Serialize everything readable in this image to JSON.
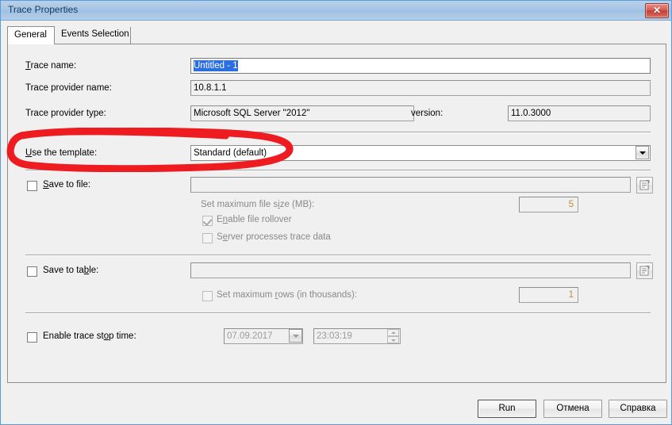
{
  "window": {
    "title": "Trace Properties",
    "close_label": "✕"
  },
  "tabs": [
    {
      "label": "General",
      "active": true
    },
    {
      "label": "Events Selection",
      "active": false
    }
  ],
  "general": {
    "trace_name": {
      "label": "Trace name:",
      "value": "Untitled - 1",
      "selected": true
    },
    "trace_provider_name": {
      "label": "Trace provider name:",
      "value": "10.8.1.1"
    },
    "trace_provider_type": {
      "label": "Trace provider type:",
      "value": "Microsoft SQL Server \"2012\""
    },
    "version": {
      "label": "version:",
      "value": "11.0.3000"
    },
    "template": {
      "label": "Use the template:",
      "value": "Standard (default)",
      "highlighted": true
    },
    "save_to_file": {
      "label": "Save to file:",
      "checked": false,
      "path_value": "",
      "browse_icon": "folder-open-icon",
      "max_file_size": {
        "label": "Set maximum file size (MB):",
        "value": "5",
        "enabled": false
      },
      "enable_rollover": {
        "label": "Enable file rollover",
        "checked": true,
        "enabled": false
      },
      "server_processes": {
        "label": "Server processes trace data",
        "checked": false,
        "enabled": false
      }
    },
    "save_to_table": {
      "label": "Save to table:",
      "checked": false,
      "table_value": "",
      "browse_icon": "folder-open-icon",
      "max_rows": {
        "label": "Set maximum rows (in thousands):",
        "checked": false,
        "value": "1",
        "enabled": false
      }
    },
    "stop_time": {
      "label": "Enable trace stop time:",
      "checked": false,
      "date_value": "07.09.2017",
      "time_value": "23:03:19",
      "enabled": false
    }
  },
  "footer": {
    "run_label": "Run",
    "cancel_label": "Отмена",
    "help_label": "Справка"
  },
  "colors": {
    "annotation": "#ee1c20",
    "titlebar_accent": "#a9c6e4",
    "selection": "#2a6ee0"
  }
}
